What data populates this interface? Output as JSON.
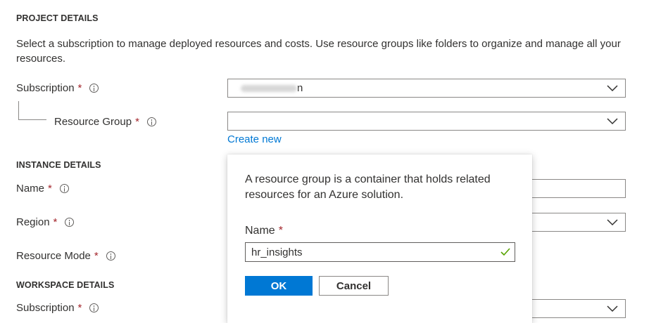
{
  "project_details": {
    "title": "PROJECT DETAILS",
    "description": "Select a subscription to manage deployed resources and costs. Use resource groups like folders to organize and manage all your resources.",
    "subscription_label": "Subscription",
    "subscription_value_visible": "n",
    "resource_group_label": "Resource Group",
    "resource_group_value": "",
    "create_new_link": "Create new"
  },
  "instance_details": {
    "title": "INSTANCE DETAILS",
    "name_label": "Name",
    "region_label": "Region",
    "resource_mode_label": "Resource Mode"
  },
  "workspace_details": {
    "title": "WORKSPACE DETAILS",
    "subscription_label": "Subscription"
  },
  "required_marker": "*",
  "popup": {
    "description": "A resource group is a container that holds related resources for an Azure solution.",
    "name_label": "Name",
    "name_value": "hr_insights",
    "ok_label": "OK",
    "cancel_label": "Cancel"
  },
  "colors": {
    "accent": "#0078d4",
    "required": "#a4262c",
    "valid_check": "#57a300"
  },
  "icons": [
    "info-icon",
    "chevron-down-icon",
    "checkmark-icon"
  ]
}
